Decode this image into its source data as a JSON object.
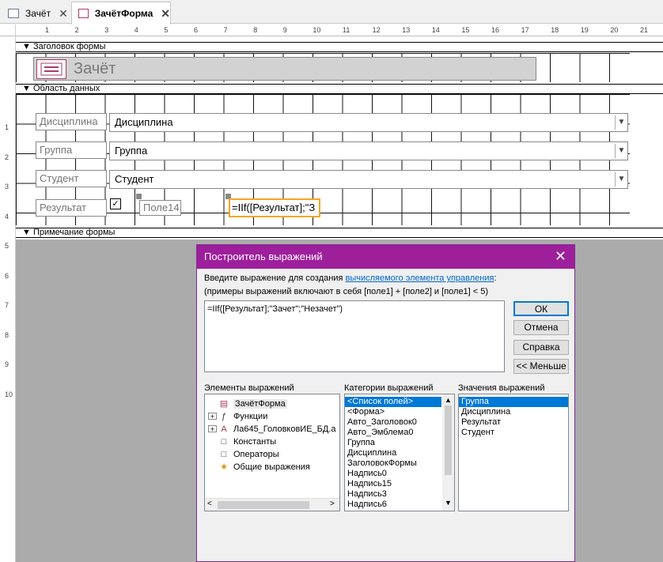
{
  "tabs": [
    {
      "label": "Зачёт",
      "icon": "table-icon"
    },
    {
      "label": "ЗачётФорма",
      "icon": "form-icon"
    }
  ],
  "ruler": {
    "h": [
      "1",
      "2",
      "3",
      "4",
      "5",
      "6",
      "7",
      "8",
      "9",
      "10",
      "11",
      "12",
      "13",
      "14",
      "15",
      "16",
      "17",
      "18",
      "19",
      "20",
      "21"
    ],
    "v": [
      "1",
      "2",
      "3",
      "4",
      "5",
      "6",
      "7",
      "8",
      "9",
      "10"
    ]
  },
  "sections": {
    "header": "Заголовок формы",
    "detail": "Область данных",
    "footer": "Примечание формы"
  },
  "form_title": "Зачёт",
  "controls": {
    "discipline_label": "Дисциплина",
    "discipline_value": "Дисциплина",
    "group_label": "Группа",
    "group_value": "Группа",
    "student_label": "Студент",
    "student_value": "Студент",
    "result_label": "Результат",
    "field14": "Поле14",
    "calc_field": "=IIf([Результат];\"З"
  },
  "dialog": {
    "title": "Построитель выражений",
    "instruction_prefix": "Введите выражение для создания ",
    "instruction_link": "вычисляемого элемента управления",
    "instruction_suffix": ":",
    "examples": "(примеры выражений включают в себя [поле1] + [поле2] и [поле1] < 5)",
    "expression": "=IIf([Результат];\"Зачет\";\"Незачет\")",
    "buttons": {
      "ok": "ОК",
      "cancel": "Отмена",
      "help": "Справка",
      "less": "<< Меньше"
    },
    "elements_header": "Элементы выражений",
    "categories_header": "Категории выражений",
    "values_header": "Значения выражений",
    "elements": [
      {
        "label": "ЗачётФорма",
        "icon": "form-icon",
        "expander": ""
      },
      {
        "label": "Функции",
        "icon": "function-icon",
        "expander": "+"
      },
      {
        "label": "Ла645_ГоловковИЕ_БД.a",
        "icon": "access-db-icon",
        "expander": "+"
      },
      {
        "label": "Константы",
        "icon": "constants-icon",
        "expander": ""
      },
      {
        "label": "Операторы",
        "icon": "operators-icon",
        "expander": ""
      },
      {
        "label": "Общие выражения",
        "icon": "common-expressions-icon",
        "expander": ""
      }
    ],
    "categories": [
      "<Список полей>",
      "<Форма>",
      "Авто_Заголовок0",
      "Авто_Эмблема0",
      "Группа",
      "Дисциплина",
      "ЗаголовокФормы",
      "Надпись0",
      "Надпись15",
      "Надпись3",
      "Надпись6"
    ],
    "values": [
      "Группа",
      "Дисциплина",
      "Результат",
      "Студент"
    ]
  },
  "colors": {
    "accent": "#9e1f9c",
    "selection": "#0078d7",
    "link": "#0066cc",
    "selected_control": "#f5a623"
  }
}
